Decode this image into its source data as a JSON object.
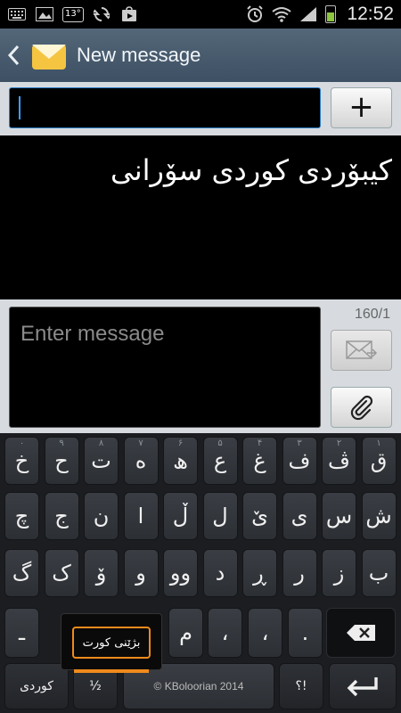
{
  "status_bar": {
    "temperature": "13°",
    "time": "12:52"
  },
  "action_bar": {
    "title": "New message"
  },
  "recipient": {
    "add_label": "+"
  },
  "thread": {
    "message_text": "کیبۆردی کوردی سۆرانی"
  },
  "compose": {
    "placeholder": "Enter message",
    "char_counter": "160/1"
  },
  "keyboard": {
    "row1": [
      {
        "label": "ق",
        "sub": "۱"
      },
      {
        "label": "ڤ",
        "sub": "۲"
      },
      {
        "label": "ف",
        "sub": "۳"
      },
      {
        "label": "غ",
        "sub": "۴"
      },
      {
        "label": "ع",
        "sub": "۵"
      },
      {
        "label": "ھ",
        "sub": "۶"
      },
      {
        "label": "ە",
        "sub": "۷"
      },
      {
        "label": "ت",
        "sub": "۸"
      },
      {
        "label": "ح",
        "sub": "۹"
      },
      {
        "label": "خ",
        "sub": "۰"
      }
    ],
    "row2": [
      "ش",
      "س",
      "ی",
      "ێ",
      "ل",
      "ڵ",
      "ا",
      "ن",
      "ج",
      "چ"
    ],
    "row3": [
      "ب",
      "ز",
      "ر",
      "ڕ",
      "د",
      "وو",
      "و",
      "ۆ",
      "ک",
      "گ"
    ],
    "row4": [
      "ـ",
      "",
      "",
      "",
      "",
      "م",
      "،",
      "،",
      "."
    ],
    "language_key": "کوردی",
    "fraction_key": "½",
    "space_label": "© KBoloorian 2014",
    "punct_key": "؟!",
    "popup_label": "بژێنی کورت"
  }
}
